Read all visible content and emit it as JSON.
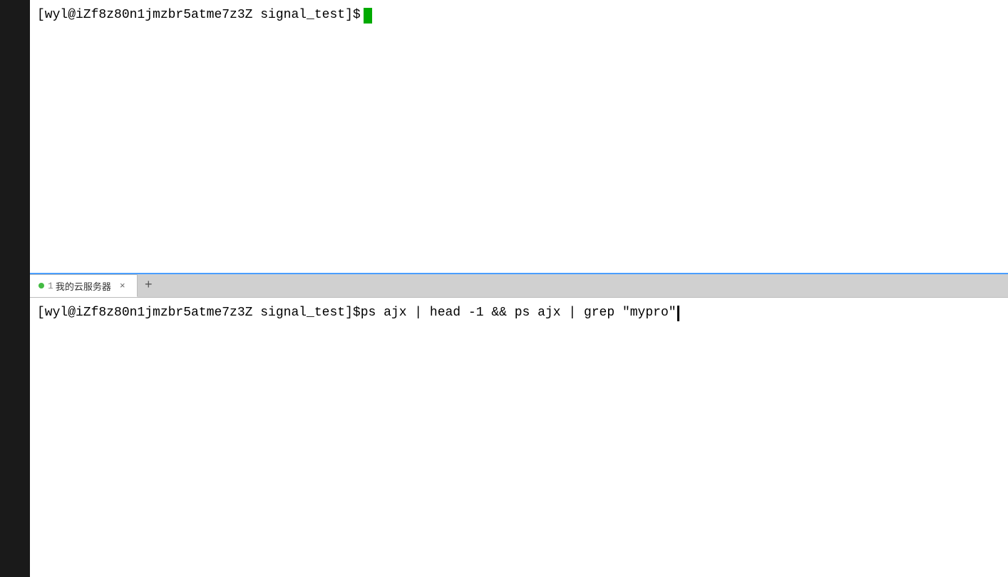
{
  "terminal": {
    "top_pane": {
      "prompt": "[wyl@iZf8z80n1jmzbr5atme7z3Z signal_test]$",
      "command": ""
    },
    "tab_bar": {
      "tabs": [
        {
          "number": "1",
          "title": "我的云服务器",
          "active": true
        }
      ],
      "add_label": "+",
      "close_label": "×"
    },
    "bottom_pane": {
      "prompt": "[wyl@iZf8z80n1jmzbr5atme7z3Z signal_test]$",
      "command": " ps ajx | head -1 && ps ajx | grep \"mypro\""
    }
  }
}
